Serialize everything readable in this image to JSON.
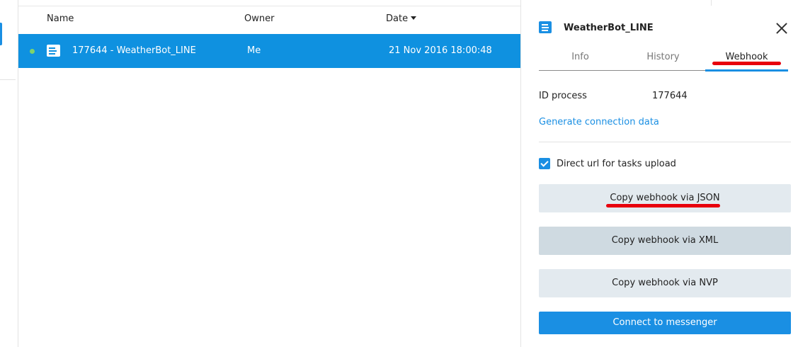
{
  "list": {
    "columns": {
      "name": "Name",
      "owner": "Owner",
      "date": "Date"
    },
    "rows": [
      {
        "name": "177644 - WeatherBot_LINE",
        "owner": "Me",
        "date": "21 Nov 2016 18:00:48"
      }
    ]
  },
  "panel": {
    "title": "WeatherBot_LINE",
    "tabs": {
      "info": "Info",
      "history": "History",
      "webhook": "Webhook"
    },
    "active_tab": "Webhook",
    "id_label": "ID process",
    "id_value": "177644",
    "generate_link": "Generate connection data",
    "direct_url_label": "Direct url for tasks upload",
    "direct_url_checked": true,
    "buttons": {
      "json": "Copy webhook via JSON",
      "xml": "Copy webhook via XML",
      "nvp": "Copy webhook via NVP",
      "connect": "Connect to messenger"
    }
  },
  "colors": {
    "accent": "#1a8fe3",
    "selected_row": "#0f91e0",
    "annotation_red": "#e8000d",
    "status_online": "#7ed36c"
  },
  "icons": {
    "process": "process-icon",
    "close": "close-icon",
    "check": "checkbox-checked-icon",
    "sort": "sort-desc-icon"
  }
}
